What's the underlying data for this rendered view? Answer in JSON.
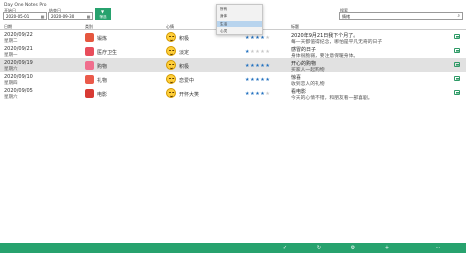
{
  "app": {
    "title": "Day One Notes Pro"
  },
  "filters": {
    "start_label": "开始日",
    "start_value": "2020-05-01",
    "end_label": "结束日",
    "end_value": "2020-09-30",
    "filter_button_label": "筛选",
    "search_label": "搜索",
    "search_value": "情绪"
  },
  "columns": {
    "date": "日期",
    "category": "类别",
    "mood": "心情",
    "title": "标题"
  },
  "dropdown": {
    "options": [
      "所有",
      "身体",
      "生活",
      "心灵"
    ],
    "selected_index": 2
  },
  "rows": [
    {
      "date": "2020/09/22",
      "weekday": "星期二",
      "category": "锻炼",
      "category_color": "#e5573f",
      "mood": "积极",
      "rating": 4,
      "title": "2020年9月21日我下个月了。",
      "body": "每一天都值得纪念，哪怕是平凡无奇的日子"
    },
    {
      "date": "2020/09/21",
      "weekday": "星期一",
      "category": "医疗卫生",
      "category_color": "#e84d5b",
      "mood": "淡定",
      "rating": 1,
      "title": "感冒的日子",
      "body": "身体很脆弱，要注意保暖身体。"
    },
    {
      "date": "2020/09/19",
      "weekday": "星期六",
      "category": "购物",
      "category_color": "#f06e8d",
      "mood": "积极",
      "rating": 5,
      "title": "开心的购物",
      "body": "买家人一起购物"
    },
    {
      "date": "2020/09/10",
      "weekday": "星期四",
      "category": "礼物",
      "category_color": "#ea5a4a",
      "mood": "恋爱中",
      "rating": 5,
      "title": "惊喜",
      "body": "收到恋人的礼物"
    },
    {
      "date": "2020/09/05",
      "weekday": "星期六",
      "category": "电影",
      "category_color": "#d83a34",
      "mood": "开怀大笑",
      "rating": 4,
      "title": "看电影",
      "body": "今天的心情不错，和朋友看一部喜剧。"
    }
  ],
  "colors": {
    "accent": "#27a26e",
    "star_on": "#1f6fbf",
    "star_off": "#c8c8c8",
    "selected_row": "#e1e1e1"
  },
  "toolbar": {
    "icons": [
      "check-icon",
      "refresh-icon",
      "settings-icon",
      "add-icon",
      "more-icon"
    ]
  }
}
